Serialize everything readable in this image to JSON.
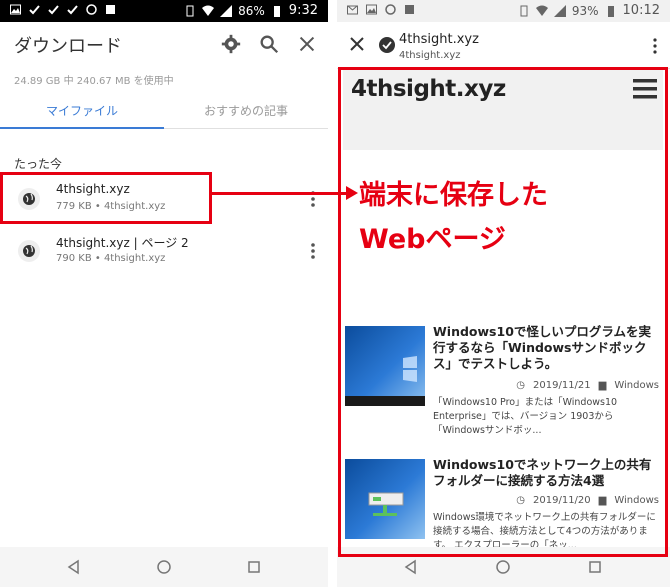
{
  "left": {
    "status": {
      "battery": "86%",
      "time": "9:32"
    },
    "title": "ダウンロード",
    "storage": "24.89 GB 中 240.67 MB を使用中",
    "tabs": [
      "マイファイル",
      "おすすめの記事"
    ],
    "section": "たった今",
    "items": [
      {
        "title": "4thsight.xyz",
        "sub": "779 KB • 4thsight.xyz"
      },
      {
        "title": "4thsight.xyz | ページ 2",
        "sub": "790 KB • 4thsight.xyz"
      }
    ]
  },
  "right": {
    "status": {
      "battery": "93%",
      "time": "10:12"
    },
    "page_title": "4thsight.xyz",
    "page_url": "4thsight.xyz",
    "site_logo": "4thsight.xyz",
    "annotation": [
      "端末に保存した",
      "Webページ"
    ],
    "articles": [
      {
        "title": "Windows10で怪しいプログラムを実行するなら「Windowsサンドボックス」でテストしよう。",
        "date": "2019/11/21",
        "category": "Windows",
        "excerpt": "「Windows10 Pro」または「Windows10 Enterprise」では、バージョン 1903から「Windowsサンドボッ..."
      },
      {
        "title": "Windows10でネットワーク上の共有フォルダーに接続する方法4選",
        "date": "2019/11/20",
        "category": "Windows",
        "excerpt": "Windows環境でネットワーク上の共有フォルダーに接続する場合、接続方法として4つの方法があります。 エクスプローラーの「ネッ..."
      }
    ]
  },
  "colors": {
    "accent_red": "#e60012",
    "tab_blue": "#3a7bd5"
  }
}
